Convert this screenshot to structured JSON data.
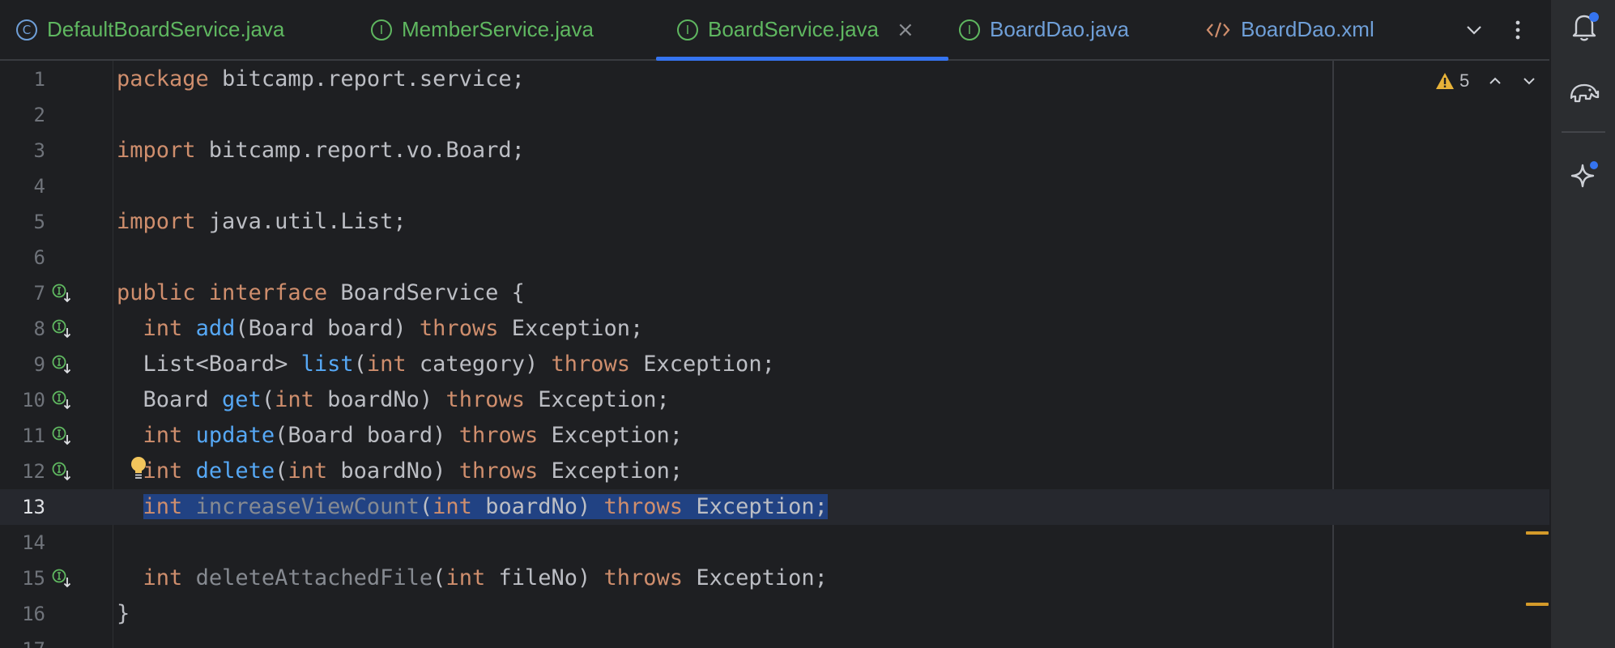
{
  "tabs": [
    {
      "label": "DefaultBoardService.java",
      "icon": "class-icon",
      "icon_glyph": "C",
      "color": "#5fb760",
      "active": false
    },
    {
      "label": "MemberService.java",
      "icon": "interface-icon",
      "icon_glyph": "I",
      "color": "#5fb760",
      "active": false
    },
    {
      "label": "BoardService.java",
      "icon": "interface-icon",
      "icon_glyph": "I",
      "color": "#5fb760",
      "active": true
    },
    {
      "label": "BoardDao.java",
      "icon": "interface-icon",
      "icon_glyph": "I",
      "color": "#6f9fd8",
      "active": false
    },
    {
      "label": "BoardDao.xml",
      "icon": "xml-icon",
      "icon_glyph": "</>",
      "color": "#6f9fd8",
      "active": false
    }
  ],
  "inspections": {
    "warning_count": "5"
  },
  "editor": {
    "current_line": 13,
    "lines": [
      {
        "n": "1",
        "text": "package bitcamp.report.service;"
      },
      {
        "n": "2",
        "text": ""
      },
      {
        "n": "3",
        "text": "import bitcamp.report.vo.Board;"
      },
      {
        "n": "4",
        "text": ""
      },
      {
        "n": "5",
        "text": "import java.util.List;"
      },
      {
        "n": "6",
        "text": ""
      },
      {
        "n": "7",
        "text": "public interface BoardService {"
      },
      {
        "n": "8",
        "text": "  int add(Board board) throws Exception;"
      },
      {
        "n": "9",
        "text": "  List<Board> list(int category) throws Exception;"
      },
      {
        "n": "10",
        "text": "  Board get(int boardNo) throws Exception;"
      },
      {
        "n": "11",
        "text": "  int update(Board board) throws Exception;"
      },
      {
        "n": "12",
        "text": "  int delete(int boardNo) throws Exception;"
      },
      {
        "n": "13",
        "text": "  int increaseViewCount(int boardNo) throws Exception;"
      },
      {
        "n": "14",
        "text": ""
      },
      {
        "n": "15",
        "text": "  int deleteAttachedFile(int fileNo) throws Exception;"
      },
      {
        "n": "16",
        "text": "}"
      },
      {
        "n": "17",
        "text": ""
      }
    ]
  },
  "colors": {
    "keyword": "#cf8e6d",
    "method": "#56a8f5",
    "unused_method": "#868a91",
    "selection": "#214283",
    "accent": "#3574f0",
    "warning": "#d49a2a"
  }
}
